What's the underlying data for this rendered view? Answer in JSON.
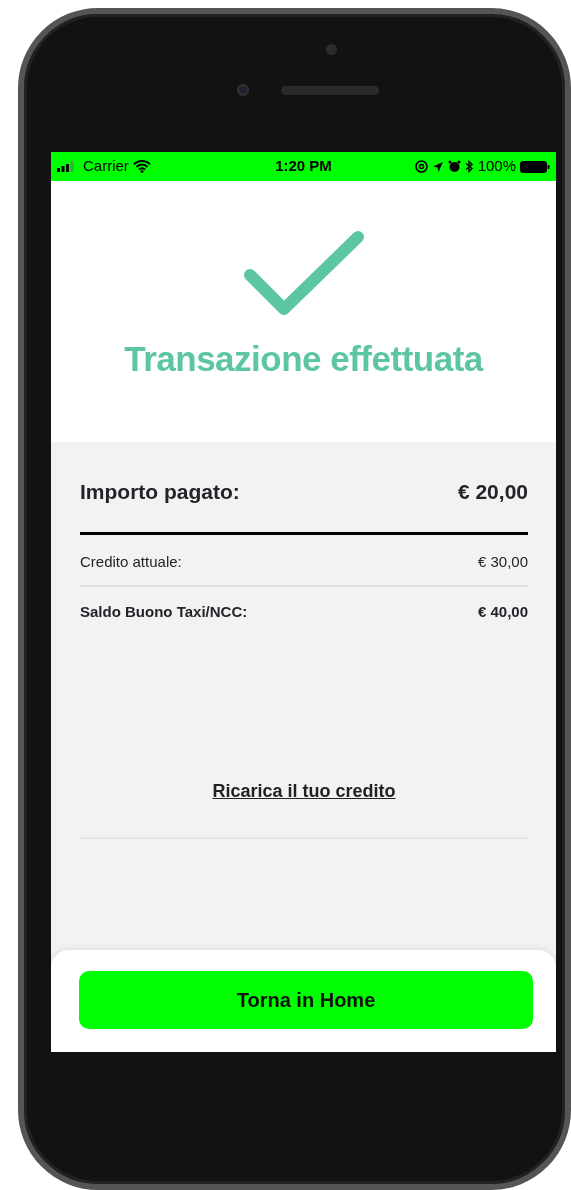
{
  "status_bar": {
    "carrier": "Carrier",
    "time": "1:20 PM",
    "battery": "100%"
  },
  "title": "Transazione effettuata",
  "rows": [
    {
      "kind": "total",
      "label": "Importo pagato:",
      "value": "€ 20,00"
    },
    {
      "kind": "regular",
      "label": "Credito attuale:",
      "value": "€ 30,00"
    },
    {
      "kind": "strong",
      "label": "Saldo Buono Taxi/NCC:",
      "value": "€ 40,00"
    }
  ],
  "link": "Ricarica il tuo credito",
  "button": "Torna in Home"
}
